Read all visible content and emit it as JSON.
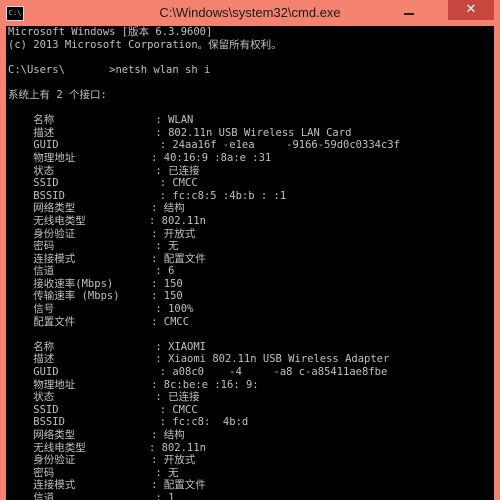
{
  "window": {
    "title": "C:\\Windows\\system32\\cmd.exe",
    "icon_text": "C:\\",
    "close_symbol": "✕",
    "accent": "#f3826f",
    "close_color": "#c7463f",
    "console_bg": "#000000",
    "console_fg": "#c0c0c0"
  },
  "console": {
    "lines": [
      "Microsoft Windows [版本 6.3.9600]",
      "(c) 2013 Microsoft Corporation。保留所有权利。",
      "",
      "C:\\Users\\       >netsh wlan sh i",
      "",
      "系统上有 2 个接口:",
      "",
      "    名称                : WLAN",
      "    描述                : 802.11n USB Wireless LAN Card",
      "    GUID                : 24aa16f -e1ea     -9166-59d0c0334c3f",
      "    物理地址            : 40:16:9 :8a:e :31",
      "    状态                : 已连接",
      "    SSID                : CMCC",
      "    BSSID               : fc:c8:5 :4b:b : :1",
      "    网络类型            : 结构",
      "    无线电类型          : 802.11n",
      "    身份验证            : 开放式",
      "    密码                : 无",
      "    连接模式            : 配置文件",
      "    信道                : 6",
      "    接收速率(Mbps)      : 150",
      "    传输速率 (Mbps)     : 150",
      "    信号                : 100%",
      "    配置文件            : CMCC",
      "",
      "    名称                : XIAOMI",
      "    描述                : Xiaomi 802.11n USB Wireless Adapter",
      "    GUID                : a08c0    -4     -a8 c-a85411ae8fbe",
      "    物理地址            : 8c:be:e :16: 9: ",
      "    状态                : 已连接",
      "    SSID                : CMCC",
      "    BSSID               : fc:c8:  4b:d ",
      "    网络类型            : 结构",
      "    无线电类型          : 802.11n",
      "    身份验证            : 开放式",
      "    密码                : 无",
      "    连接模式            : 配置文件",
      "    信道                : 1"
    ]
  }
}
